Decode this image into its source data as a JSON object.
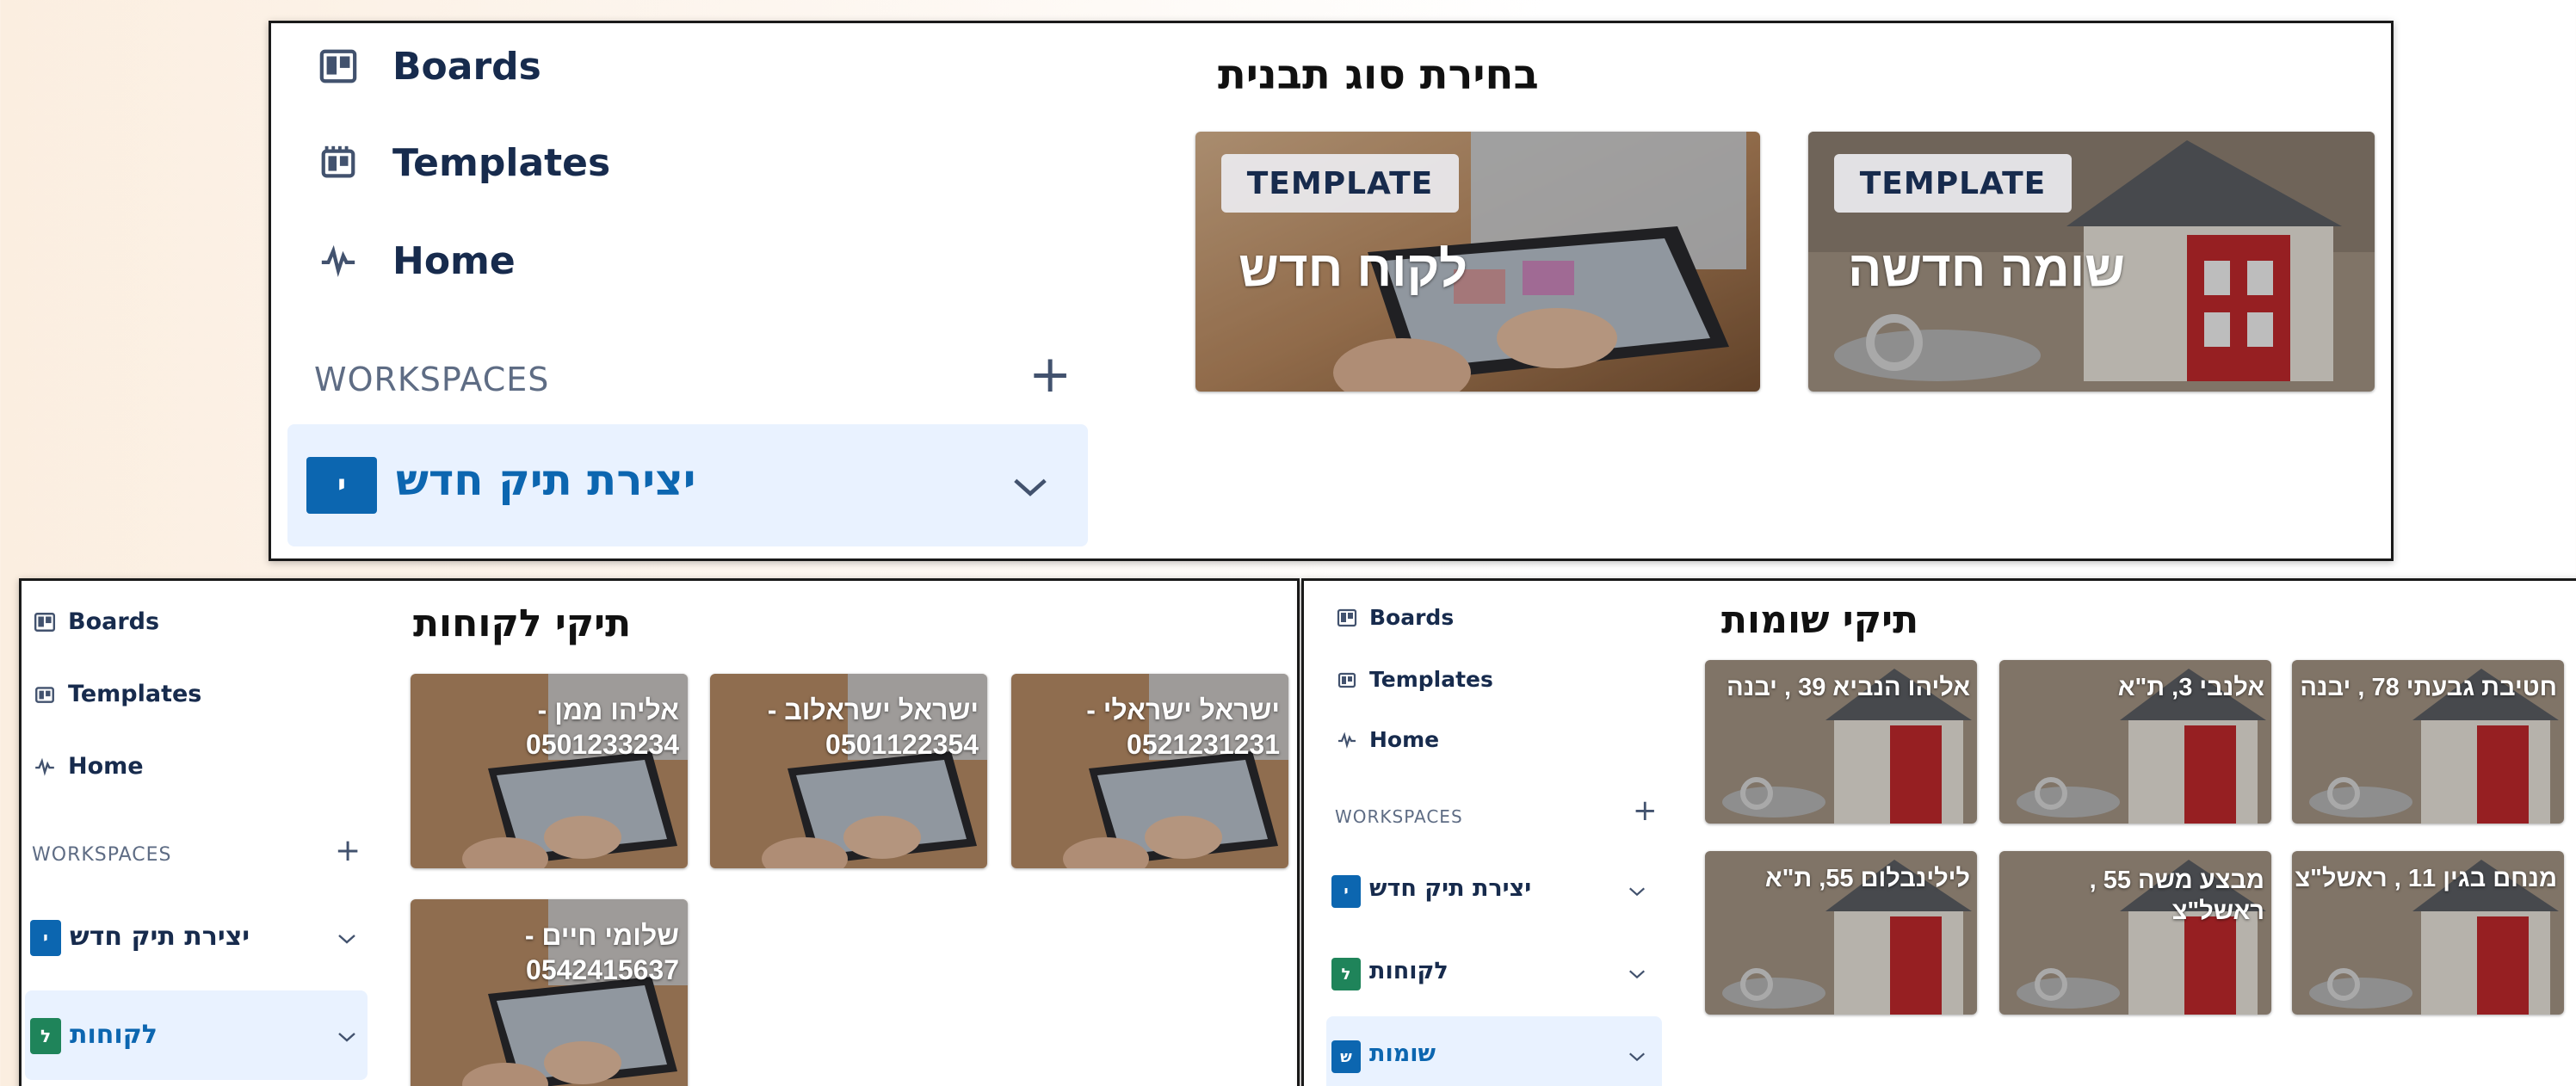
{
  "nav": {
    "boards": "Boards",
    "templates": "Templates",
    "home": "Home",
    "workspaces": "WORKSPACES",
    "plus": "+"
  },
  "workspaces": {
    "new_file": {
      "badge": "י",
      "name": "יצירת תיק חדש",
      "color": "#0c66b0"
    },
    "clients": {
      "badge": "ל",
      "name": "לקוחות",
      "color": "#1f845a"
    },
    "estimates": {
      "badge": "ש",
      "name": "שומות",
      "color": "#0c66b0"
    }
  },
  "top_panel": {
    "title": "בחירת סוג תבנית",
    "cards": [
      {
        "badge": "TEMPLATE",
        "title": "לקוח חדש",
        "image": "tablet-photo"
      },
      {
        "badge": "TEMPLATE",
        "title": "שומה חדשה",
        "image": "house-photo"
      }
    ]
  },
  "clients_panel": {
    "title": "תיקי לקוחות",
    "cards": [
      {
        "title": "ישראל ישראלי -\n0521231231"
      },
      {
        "title": "ישראל ישראלוב -\n0501122354"
      },
      {
        "title": "אליהו ממן -\n0501233234"
      },
      {
        "title": "שלומי חיים -\n0542415637"
      }
    ]
  },
  "estimates_panel": {
    "title": "תיקי שומות",
    "cards": [
      {
        "title": "חטיבת גבעתי 78 , יבנה"
      },
      {
        "title": "אלנבי 3, ת\"א"
      },
      {
        "title": "אליהו הנביא 39 , יבנה"
      },
      {
        "title": "מנחם בגין 11 , ראשל\"צ"
      },
      {
        "title": "מבצע משה 55 ,\nראשל\"צ"
      },
      {
        "title": "לילינבלום 55, ת\"א"
      }
    ]
  },
  "colors": {
    "nav_text": "#172b4d",
    "active_row": "#e9f2ff",
    "active_text": "#0c66b0"
  }
}
